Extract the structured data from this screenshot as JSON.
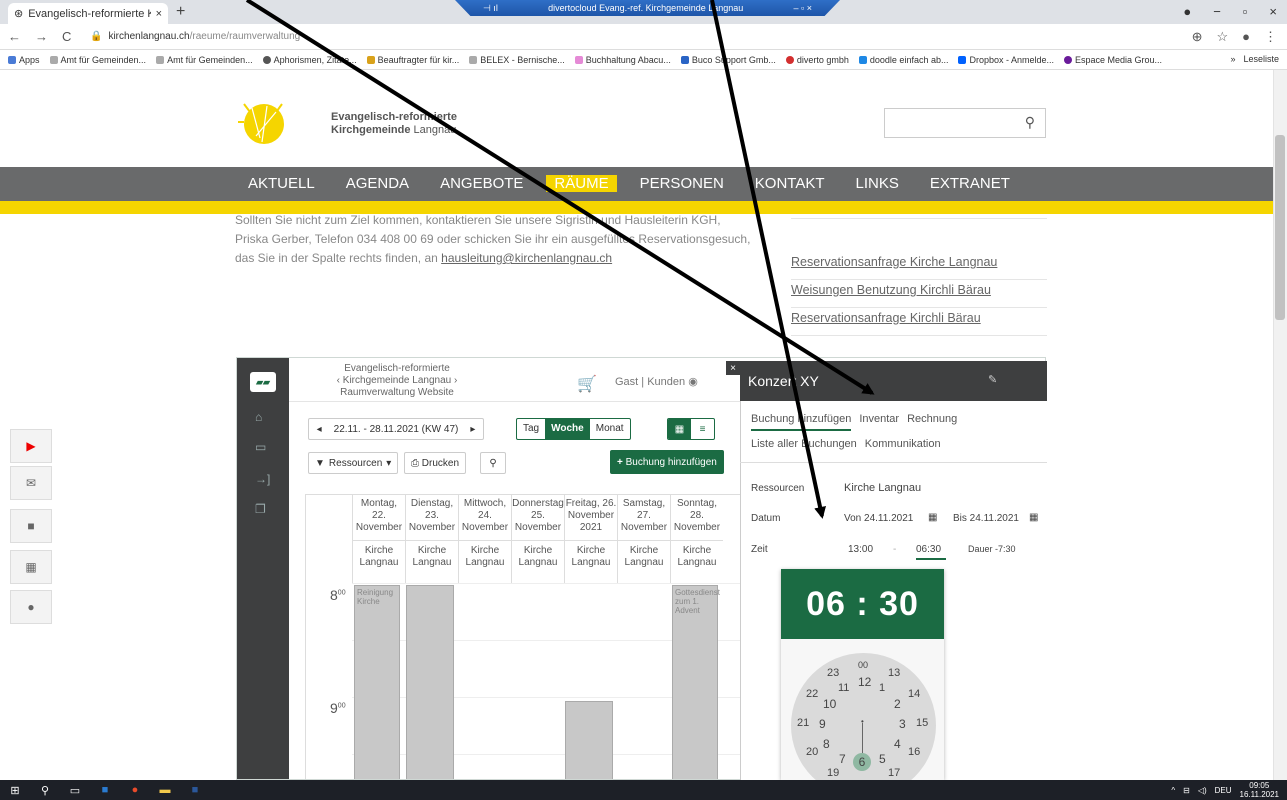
{
  "browser": {
    "tab_title": "Evangelisch-reformierte Kirchge",
    "remote_title": "divertocloud Evang.-ref. Kirchgemeinde Langnau",
    "url_domain": "kirchenlangnau.ch",
    "url_path": "/raeume/raumverwaltung",
    "bookmarks": [
      "Apps",
      "Amt für Gemeinden...",
      "Amt für Gemeinden...",
      "Aphorismen, Zitate...",
      "Beauftragter für kir...",
      "BELEX - Bernische...",
      "Buchhaltung Abacu...",
      "Buco Support Gmb...",
      "diverto gmbh",
      "doodle einfach ab...",
      "Dropbox - Anmelde...",
      "Espace Media Grou..."
    ],
    "reading_list": "Leseliste"
  },
  "site": {
    "brand_line1": "Evangelisch-reformierte",
    "brand_line2a": "Kirchgemeinde",
    "brand_line2b": "Langnau",
    "nav": [
      "AKTUELL",
      "AGENDA",
      "ANGEBOTE",
      "RÄUME",
      "PERSONEN",
      "KONTAKT",
      "LINKS",
      "EXTRANET"
    ],
    "intro_text": "Sollten Sie nicht zum Ziel kommen, kontaktieren Sie unsere Sigristin und Hausleiterin KGH, Priska Gerber, Telefon 034 408 00 69 oder schicken Sie ihr ein ausgefülltes Reservationsgesuch, das Sie in der Spalte rechts finden, an",
    "intro_link": "hausleitung@kirchenlangnau.ch",
    "links": [
      "Reservationsanfrage Kirche Langnau",
      "Weisungen Benutzung Kirchli Bärau",
      "Reservationsanfrage Kirchli Bärau"
    ]
  },
  "widget": {
    "title_line1": "Evangelisch-reformierte",
    "title_line2": "Kirchgemeinde Langnau",
    "title_line3": "Raumverwaltung Website",
    "user": "Gast | Kunden",
    "date_range": "22.11. - 28.11.2021 (KW 47)",
    "views": [
      "Tag",
      "Woche",
      "Monat"
    ],
    "resources_btn": "Ressourcen",
    "print_btn": "Drucken",
    "add_btn": "Buchung hinzufügen",
    "days": [
      {
        "l1": "Montag,",
        "l2": "22.",
        "l3": "November",
        "res": "Kirche Langnau"
      },
      {
        "l1": "Dienstag,",
        "l2": "23.",
        "l3": "November",
        "res": "Kirche Langnau"
      },
      {
        "l1": "Mittwoch,",
        "l2": "24.",
        "l3": "November",
        "res": "Kirche Langnau"
      },
      {
        "l1": "Donnerstag",
        "l2": "25.",
        "l3": "November",
        "res": "Kirche Langnau"
      },
      {
        "l1": "Freitag, 26.",
        "l2": "November",
        "l3": "2021",
        "res": "Kirche Langnau"
      },
      {
        "l1": "Samstag,",
        "l2": "27.",
        "l3": "November",
        "res": "Kirche Langnau"
      },
      {
        "l1": "Sonntag,",
        "l2": "28.",
        "l3": "November",
        "res": "Kirche Langnau"
      }
    ],
    "hour8": "8",
    "hour9": "9",
    "hour_sup": "00",
    "event_mon": "Reinigung Kirche",
    "event_sun": "Gottesdienst zum 1. Advent"
  },
  "panel": {
    "title": "Konzert XY",
    "tabs_row1": [
      "Buchung hinzufügen",
      "Inventar",
      "Rechnung"
    ],
    "tabs_row2": [
      "Liste aller Buchungen",
      "Kommunikation"
    ],
    "res_label": "Ressourcen",
    "res_value": "Kirche Langnau",
    "date_label": "Datum",
    "date_from": "Von 24.11.2021",
    "date_to": "Bis 24.11.2021",
    "time_label": "Zeit",
    "time_from": "13:00",
    "time_sep": "-",
    "time_to": "06:30",
    "duration": "Dauer -7:30",
    "clock_display": "06 : 30"
  },
  "taskbar": {
    "lang": "DEU",
    "time": "09:05",
    "date": "16.11.2021"
  }
}
